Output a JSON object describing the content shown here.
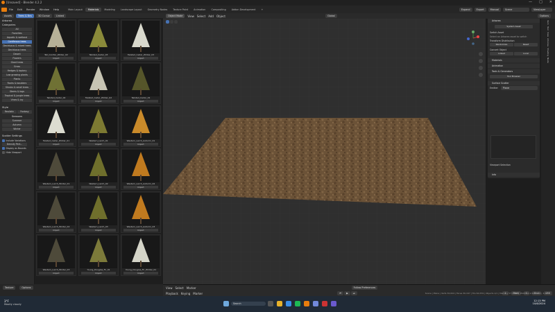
{
  "window": {
    "title": "[Unsaved] - Blender 4.2.2",
    "controls": [
      "—",
      "□",
      "✕"
    ]
  },
  "menu": [
    "File",
    "Edit",
    "Render",
    "Window",
    "Help"
  ],
  "workspaces": [
    "Main Layout",
    "Materials",
    "Modeling",
    "Landscape Layout",
    "Geometry Nodes",
    "Texture Paint",
    "Animation",
    "Compositing",
    "Addon Development"
  ],
  "active_workspace": "Materials",
  "header_right": {
    "scene_label": "Scene",
    "viewlayer_label": "ViewLayer",
    "buttons": [
      "Expand",
      "Export",
      "Manual"
    ]
  },
  "asset_browser": {
    "editor_label": "Assets",
    "library": "Trees & Bns",
    "filter": "3D Cursor",
    "selection": "Linked"
  },
  "left_panel": {
    "title": "Arborea",
    "categories_title": "Categories",
    "categories": [
      "All",
      "Favorites",
      "Aquatic & wetland",
      "Coniferous trees",
      "Deciduous & mixed trees",
      "Deciduous trees",
      "Desert",
      "Flowers",
      "Giant trees",
      "Grass",
      "Hedges & topiary",
      "Low growing plants",
      "Plants",
      "Rocks & boulders",
      "Shrubs & small trees",
      "Stems & logs",
      "Tropical & jungle trees",
      "Vines & ivy"
    ],
    "selected_category": "Coniferous trees",
    "style_title": "Style",
    "styles": [
      "Realistic",
      "Fantasy"
    ],
    "seasons_title": "Seasons",
    "seasons": [
      "Summer",
      "Autumn",
      "Winter"
    ],
    "scatter_title": "Scatter Settings",
    "include_variations": "Include Variations",
    "density": "Density Pert...",
    "display_bounds": "Display as Bounds",
    "hide_viewport": "Hide Viewport"
  },
  "assets": [
    {
      "name": "Tall_Conifer_Winter_02",
      "button": "Import"
    },
    {
      "name": "Twisted_Cedar_03",
      "button": "Import"
    },
    {
      "name": "Twisted_Cedar_Winter_03",
      "button": "Import"
    },
    {
      "name": "Twisted_Cedar_02",
      "button": "Import"
    },
    {
      "name": "Twisted_Cedar_Winter_02",
      "button": "Import"
    },
    {
      "name": "Twisted_Cedar_01",
      "button": "Import"
    },
    {
      "name": "Twisted_Cedar_Winter_01",
      "button": "Import"
    },
    {
      "name": "Western_Larch_01",
      "button": "Import"
    },
    {
      "name": "Western_Larch_Autumn_01",
      "button": "Import"
    },
    {
      "name": "Western_Larch_Winter_01",
      "button": "Import"
    },
    {
      "name": "Western_Larch_02",
      "button": "Import"
    },
    {
      "name": "Western_Larch_Autumn_02",
      "button": "Import"
    },
    {
      "name": "Western_Larch_Winter_02",
      "button": "Import"
    },
    {
      "name": "Western_Larch_03",
      "button": "Import"
    },
    {
      "name": "Western_Larch_Autumn_03",
      "button": "Import"
    },
    {
      "name": "Western_Larch_Winter_03",
      "button": "Import"
    },
    {
      "name": "Young_Douglas_Fir_01",
      "button": "Import"
    },
    {
      "name": "Young_Douglas_Fir_Winter_01",
      "button": "Import"
    }
  ],
  "viewport": {
    "mode": "Object Mode",
    "menus": [
      "View",
      "Select",
      "Add",
      "Object"
    ],
    "orientation": "Global",
    "options": "Options"
  },
  "side_panel": {
    "title": "Arborea",
    "system_asset": "System Asset",
    "switch_asset": "Switch Asset",
    "switch_hint": "Select an Arborea asset to switch",
    "transform_title": "Transform Distribution",
    "transform_btns": [
      "Randomize",
      "Reset"
    ],
    "convert_title": "Convert Object",
    "convert_btns": [
      "Linked",
      "Local"
    ],
    "sections": [
      "Materials",
      "Animation",
      "Tools & Generators"
    ],
    "tool_btn": "Tool Browser",
    "scatter_title": "Surface Scatter",
    "emitter_label": "Emitter",
    "emitter_value": "Plane",
    "viewport_sel": "Viewport Selection",
    "info": "Info"
  },
  "ntabs": [
    "Item",
    "Tool",
    "View",
    "Arborea",
    "Shading",
    "Node"
  ],
  "timeline": {
    "menus": [
      "View",
      "Select",
      "Marker",
      "Playback",
      "Keying",
      "Marker"
    ],
    "prefs": "Follow Preferences",
    "frame": "1",
    "start": "Start",
    "start_val": "1",
    "end": "End",
    "end_val": "250"
  },
  "status": {
    "texture": "Texture",
    "options": "Options"
  },
  "stats_text": "Scene | Plane | Verts 30,624 | Faces 30,167 | Tris 60,334 | Objects 1/1 | Memory 57.3 MiB | VRAM 12.2/24.0 GiB | 4.2.2",
  "taskbar": {
    "weather_temp": "3°F",
    "weather_desc": "Mostly cloudy",
    "search": "Search",
    "time": "12:13 PM",
    "date": "10/6/2024"
  },
  "colors": {
    "accent": "#4772b3",
    "ground": "#6b5237"
  }
}
